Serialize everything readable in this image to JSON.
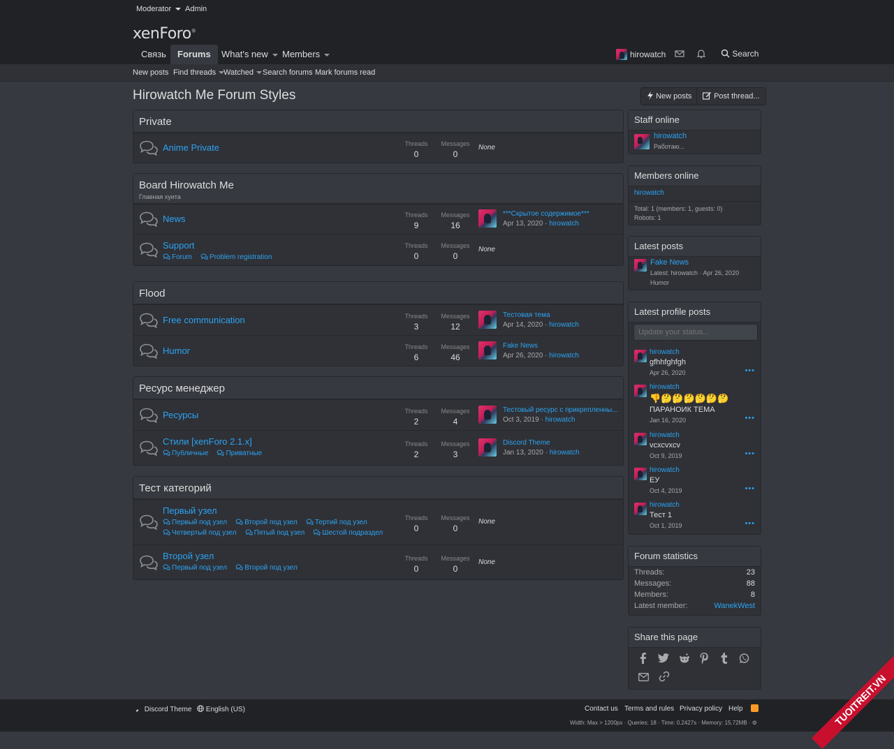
{
  "staff_bar": {
    "moderator": "Moderator",
    "admin": "Admin"
  },
  "header": {
    "logo": "xenForo",
    "nav": [
      "Связь",
      "Forums",
      "What's new",
      "Members"
    ],
    "username": "hirowatch",
    "search": "Search"
  },
  "subnav": [
    "New posts",
    "Find threads",
    "Watched",
    "Search forums",
    "Mark forums read"
  ],
  "page": {
    "title": "Hirowatch Me Forum Styles",
    "new_posts": "New posts",
    "post_thread": "Post thread..."
  },
  "labels": {
    "threads": "Threads",
    "messages": "Messages",
    "none": "None"
  },
  "categories": [
    {
      "title": "Private",
      "desc": "",
      "nodes": [
        {
          "title": "Anime Private",
          "threads": "0",
          "messages": "0",
          "none": "None"
        }
      ]
    },
    {
      "title": "Board Hirowatch Me",
      "desc": "Главная хуита",
      "nodes": [
        {
          "title": "News",
          "threads": "9",
          "messages": "16",
          "last_title": "***Скрытое содержимое***",
          "last_date": "Apr 13, 2020",
          "last_user": "hirowatch"
        },
        {
          "title": "Support",
          "subforums": [
            "Forum",
            "Problem registration"
          ],
          "threads": "0",
          "messages": "0",
          "none": "None"
        }
      ]
    },
    {
      "title": "Flood",
      "desc": "",
      "nodes": [
        {
          "title": "Free communication",
          "threads": "3",
          "messages": "12",
          "last_title": "Тестовая тема",
          "last_date": "Apr 14, 2020",
          "last_user": "hirowatch"
        },
        {
          "title": "Humor",
          "threads": "6",
          "messages": "46",
          "last_title": "Fake News",
          "last_date": "Apr 26, 2020",
          "last_user": "hirowatch"
        }
      ]
    },
    {
      "title": "Ресурс менеджер",
      "desc": "",
      "nodes": [
        {
          "title": "Ресурсы",
          "threads": "2",
          "messages": "4",
          "last_title": "Тестовый ресурс с прикрепленны...",
          "last_date": "Oct 3, 2019",
          "last_user": "hirowatch"
        },
        {
          "title": "Стили [xenForo 2.1.x]",
          "subforums": [
            "Публичные",
            "Приватные"
          ],
          "threads": "2",
          "messages": "3",
          "last_title": "Discord Theme",
          "last_date": "Jan 13, 2020",
          "last_user": "hirowatch"
        }
      ]
    },
    {
      "title": "Тест категорий",
      "desc": "",
      "nodes": [
        {
          "title": "Первый узел",
          "subforums": [
            "Первый под узел",
            "Второй под узел",
            "Тертий под узел"
          ],
          "subforums2": [
            "Четвертый под узел",
            "Пятый под узел",
            "Шестой подраздел"
          ],
          "threads": "0",
          "messages": "0",
          "none": "None"
        },
        {
          "title": "Второй узел",
          "subforums": [
            "Первый под узел",
            "Второй под узел"
          ],
          "threads": "0",
          "messages": "0",
          "none": "None"
        }
      ]
    }
  ],
  "sidebar": {
    "staff": {
      "title": "Staff online",
      "user": "hirowatch",
      "status": "Работаю..."
    },
    "members": {
      "title": "Members online",
      "user": "hirowatch",
      "total": "Total: 1 (members: 1, guests: 0)",
      "robots": "Robots: 1"
    },
    "latest_posts": {
      "title": "Latest posts",
      "thread": "Fake News",
      "meta": "Latest: hirowatch · Apr 26, 2020",
      "forum": "Humor"
    },
    "profile_posts": {
      "title": "Latest profile posts",
      "placeholder": "Update your status...",
      "posts": [
        {
          "user": "hirowatch",
          "text": "gfhhfghfgh",
          "date": "Apr 26, 2020"
        },
        {
          "user": "hirowatch",
          "emoji": "👎🤔🤔🤔🤔🤔🤔",
          "text": "ПАРАНОИК ТЕМА",
          "date": "Jan 16, 2020"
        },
        {
          "user": "hirowatch",
          "text": "vcxcvxcv",
          "date": "Oct 9, 2019"
        },
        {
          "user": "hirowatch",
          "text": "ЕУ",
          "date": "Oct 4, 2019"
        },
        {
          "user": "hirowatch",
          "text": "Тест 1",
          "date": "Oct 1, 2019"
        }
      ]
    },
    "stats": {
      "title": "Forum statistics",
      "rows": [
        {
          "label": "Threads:",
          "value": "23"
        },
        {
          "label": "Messages:",
          "value": "88"
        },
        {
          "label": "Members:",
          "value": "8"
        },
        {
          "label": "Latest member:",
          "value": "WanekWest"
        }
      ]
    },
    "share": {
      "title": "Share this page",
      "icons": [
        "facebook-icon",
        "twitter-icon",
        "reddit-icon",
        "pinterest-icon",
        "tumblr-icon",
        "whatsapp-icon",
        "email-icon",
        "link-icon"
      ]
    }
  },
  "footer": {
    "theme": "Discord Theme",
    "language": "English (US)",
    "links": [
      "Contact us",
      "Terms and rules",
      "Privacy policy",
      "Help"
    ],
    "debug": "Width: Max > 1200px · Queries: 18 · Time: 0.2427s · Memory: 15.72MB · ⚙"
  },
  "watermark": "TUOITREIT.VN",
  "colors": {
    "link": "#2da3f3",
    "bg": "#36393f",
    "panel": "#2f3136",
    "bar": "#202225"
  }
}
